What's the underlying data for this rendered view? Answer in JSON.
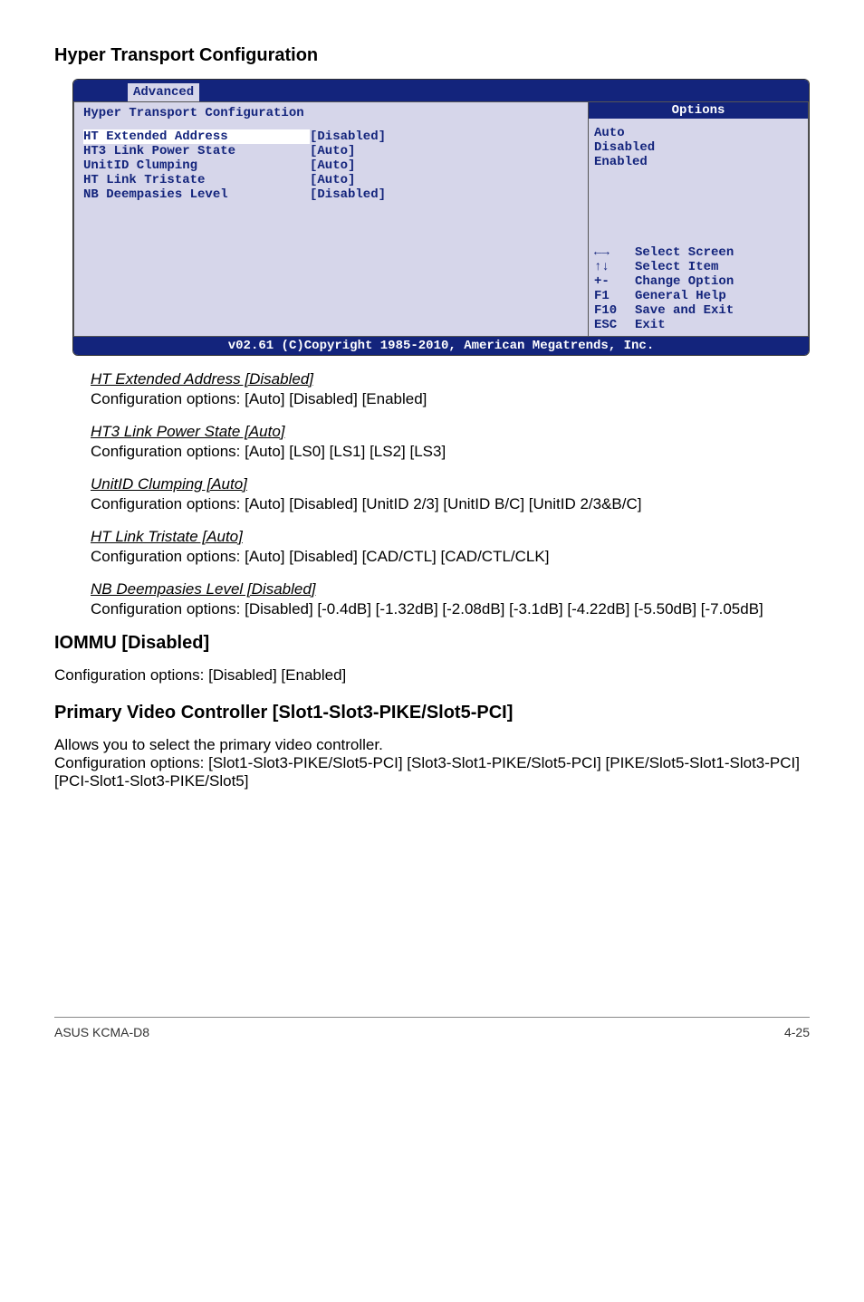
{
  "section1_title": "Hyper Transport Configuration",
  "bios": {
    "tab": "Advanced",
    "panel_title": "Hyper Transport Configuration",
    "options_label": "Options",
    "fields": [
      {
        "key": "HT Extended Address",
        "val": "[Disabled]"
      },
      {
        "key": "HT3 Link Power State",
        "val": "[Auto]"
      },
      {
        "key": "UnitID Clumping",
        "val": "[Auto]"
      },
      {
        "key": "HT Link Tristate",
        "val": "[Auto]"
      },
      {
        "key": "NB Deempasies Level",
        "val": "[Disabled]"
      }
    ],
    "option_values": [
      "Auto",
      "Disabled",
      "Enabled"
    ],
    "nav": [
      {
        "k": "←→",
        "v": "Select Screen"
      },
      {
        "k": "↑↓",
        "v": "Select Item"
      },
      {
        "k": "+-",
        "v": "Change Option"
      },
      {
        "k": "F1",
        "v": "General Help"
      },
      {
        "k": "F10",
        "v": "Save and Exit"
      },
      {
        "k": "ESC",
        "v": "Exit"
      }
    ],
    "footer": "v02.61 (C)Copyright 1985-2010, American Megatrends, Inc."
  },
  "items": [
    {
      "title": "HT Extended Address [Disabled]",
      "text": "Configuration options: [Auto] [Disabled] [Enabled]"
    },
    {
      "title": "HT3 Link Power State [Auto]",
      "text": "Configuration options: [Auto] [LS0] [LS1] [LS2] [LS3]"
    },
    {
      "title": "UnitID Clumping [Auto]",
      "text": "Configuration options: [Auto] [Disabled] [UnitID 2/3] [UnitID B/C] [UnitID 2/3&B/C]"
    },
    {
      "title": "HT Link Tristate [Auto]",
      "text": "Configuration options: [Auto] [Disabled] [CAD/CTL] [CAD/CTL/CLK]"
    },
    {
      "title": "NB Deempasies Level [Disabled]",
      "text": "Configuration options: [Disabled] [-0.4dB] [-1.32dB] [-2.08dB] [-3.1dB] [-4.22dB] [-5.50dB] [-7.05dB]"
    }
  ],
  "section2": {
    "title": "IOMMU [Disabled]",
    "text": "Configuration options: [Disabled] [Enabled]"
  },
  "section3": {
    "title": "Primary Video Controller [Slot1-Slot3-PIKE/Slot5-PCI]",
    "text": "Allows you to select the primary video controller.\nConfiguration options: [Slot1-Slot3-PIKE/Slot5-PCI] [Slot3-Slot1-PIKE/Slot5-PCI] [PIKE/Slot5-Slot1-Slot3-PCI] [PCI-Slot1-Slot3-PIKE/Slot5]"
  },
  "footer": {
    "left": "ASUS KCMA-D8",
    "right": "4-25"
  }
}
